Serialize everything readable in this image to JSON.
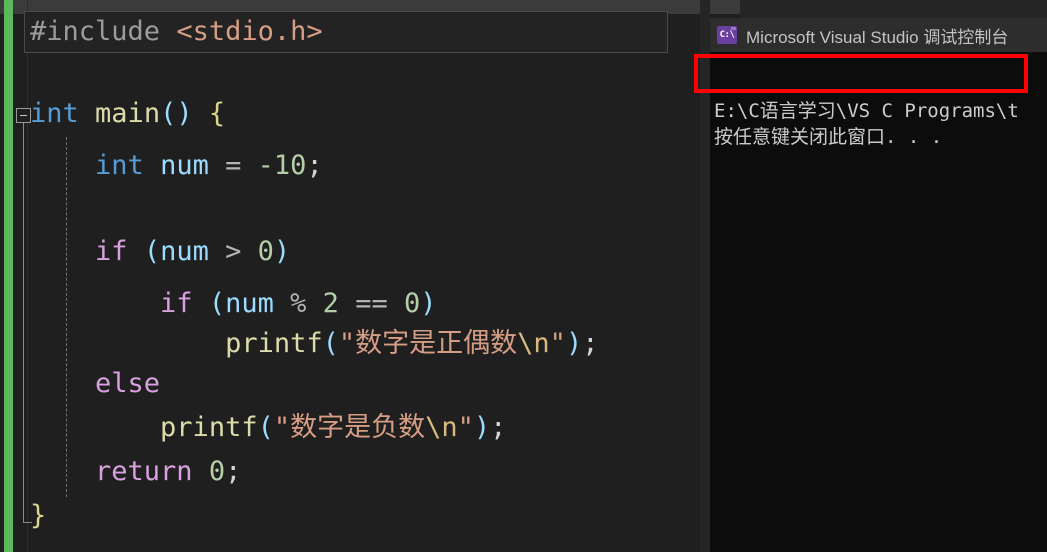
{
  "editor": {
    "name": "visual-studio-code-editor",
    "background": "#1f1f1f",
    "change_bar_color": "#5bb85b",
    "fold_state": "expanded",
    "code_lines": [
      {
        "n": 1,
        "text": "#include <stdio.h>",
        "highlighted": true,
        "tokens": [
          {
            "t": "#include ",
            "c": "t-pre"
          },
          {
            "t": "<stdio.h>",
            "c": "t-hdr"
          }
        ]
      },
      {
        "n": 2,
        "text": "",
        "tokens": []
      },
      {
        "n": 3,
        "text": "int main() {",
        "tokens": [
          {
            "t": "int",
            "c": "t-kw"
          },
          {
            "t": " ",
            "c": "t-punc"
          },
          {
            "t": "main",
            "c": "t-fn"
          },
          {
            "t": "()",
            "c": "t-paren"
          },
          {
            "t": " ",
            "c": "t-punc"
          },
          {
            "t": "{",
            "c": "t-brace"
          }
        ]
      },
      {
        "n": 4,
        "text": "    int num = -10;",
        "tokens": [
          {
            "t": "    ",
            "c": "t-punc"
          },
          {
            "t": "int",
            "c": "t-kw"
          },
          {
            "t": " ",
            "c": "t-punc"
          },
          {
            "t": "num",
            "c": "t-var"
          },
          {
            "t": " ",
            "c": "t-punc"
          },
          {
            "t": "=",
            "c": "t-op"
          },
          {
            "t": " ",
            "c": "t-punc"
          },
          {
            "t": "-10",
            "c": "t-num"
          },
          {
            "t": ";",
            "c": "t-punc"
          }
        ]
      },
      {
        "n": 5,
        "text": "",
        "tokens": []
      },
      {
        "n": 6,
        "text": "    if (num > 0)",
        "tokens": [
          {
            "t": "    ",
            "c": "t-punc"
          },
          {
            "t": "if",
            "c": "t-ctrl"
          },
          {
            "t": " ",
            "c": "t-punc"
          },
          {
            "t": "(",
            "c": "t-paren"
          },
          {
            "t": "num",
            "c": "t-var"
          },
          {
            "t": " ",
            "c": "t-punc"
          },
          {
            "t": ">",
            "c": "t-op"
          },
          {
            "t": " ",
            "c": "t-punc"
          },
          {
            "t": "0",
            "c": "t-num"
          },
          {
            "t": ")",
            "c": "t-paren"
          }
        ]
      },
      {
        "n": 7,
        "text": "        if (num % 2 == 0)",
        "tokens": [
          {
            "t": "        ",
            "c": "t-punc"
          },
          {
            "t": "if",
            "c": "t-ctrl"
          },
          {
            "t": " ",
            "c": "t-punc"
          },
          {
            "t": "(",
            "c": "t-paren"
          },
          {
            "t": "num",
            "c": "t-var"
          },
          {
            "t": " ",
            "c": "t-punc"
          },
          {
            "t": "%",
            "c": "t-op"
          },
          {
            "t": " ",
            "c": "t-punc"
          },
          {
            "t": "2",
            "c": "t-num"
          },
          {
            "t": " ",
            "c": "t-punc"
          },
          {
            "t": "==",
            "c": "t-op"
          },
          {
            "t": " ",
            "c": "t-punc"
          },
          {
            "t": "0",
            "c": "t-num"
          },
          {
            "t": ")",
            "c": "t-paren"
          }
        ]
      },
      {
        "n": 8,
        "text": "            printf(\"数字是正偶数\\n\");",
        "tokens": [
          {
            "t": "            ",
            "c": "t-punc"
          },
          {
            "t": "printf",
            "c": "t-fn"
          },
          {
            "t": "(",
            "c": "t-paren"
          },
          {
            "t": "\"数字是正偶数",
            "c": "t-str"
          },
          {
            "t": "\\n",
            "c": "t-esc"
          },
          {
            "t": "\"",
            "c": "t-str"
          },
          {
            "t": ")",
            "c": "t-paren"
          },
          {
            "t": ";",
            "c": "t-punc"
          }
        ]
      },
      {
        "n": 9,
        "text": "    else",
        "tokens": [
          {
            "t": "    ",
            "c": "t-punc"
          },
          {
            "t": "else",
            "c": "t-ctrl"
          }
        ]
      },
      {
        "n": 10,
        "text": "        printf(\"数字是负数\\n\");",
        "tokens": [
          {
            "t": "        ",
            "c": "t-punc"
          },
          {
            "t": "printf",
            "c": "t-fn"
          },
          {
            "t": "(",
            "c": "t-paren"
          },
          {
            "t": "\"数字是负数",
            "c": "t-str"
          },
          {
            "t": "\\n",
            "c": "t-esc"
          },
          {
            "t": "\"",
            "c": "t-str"
          },
          {
            "t": ")",
            "c": "t-paren"
          },
          {
            "t": ";",
            "c": "t-punc"
          }
        ]
      },
      {
        "n": 11,
        "text": "    return 0;",
        "tokens": [
          {
            "t": "    ",
            "c": "t-punc"
          },
          {
            "t": "return",
            "c": "t-ctrl"
          },
          {
            "t": " ",
            "c": "t-punc"
          },
          {
            "t": "0",
            "c": "t-num"
          },
          {
            "t": ";",
            "c": "t-punc"
          }
        ]
      },
      {
        "n": 12,
        "text": "}",
        "tokens": [
          {
            "t": "}",
            "c": "t-brace"
          }
        ]
      }
    ]
  },
  "console": {
    "title": "Microsoft Visual Studio 调试控制台",
    "icon_label": "C:\\",
    "icon_name": "console-app-icon",
    "background": "#0c0c0c",
    "titlebar_background": "#2d2d2d",
    "output_lines": [
      "E:\\C语言学习\\VS C Programs\\t",
      "按任意键关闭此窗口. . ."
    ]
  },
  "annotation": {
    "type": "rectangle-highlight",
    "color": "#ff0000",
    "stroke_width": 4
  }
}
